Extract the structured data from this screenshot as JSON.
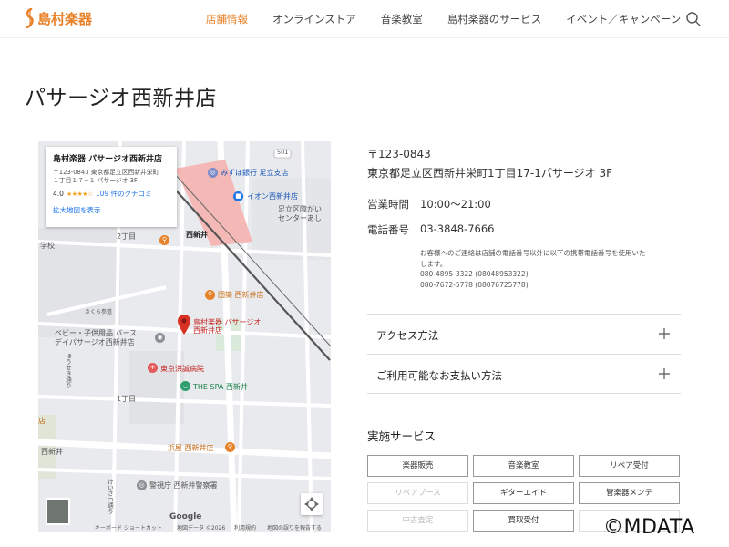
{
  "header": {
    "logo_text": "島村楽器",
    "nav": [
      "店舗情報",
      "オンラインストア",
      "音楽教室",
      "島村楽器のサービス",
      "イベント／キャンペーン"
    ],
    "accent": "#e8822a",
    "search_icon": "search-icon"
  },
  "page": {
    "title": "パサージオ西新井店"
  },
  "map": {
    "card": {
      "name": "島村楽器 パサージオ西新井店",
      "address_line1": "〒123-0843 東京都足立区西新井栄町",
      "address_line2": "１丁目１７−１ パサージオ 3F",
      "rating": "4.0",
      "stars": "★★★★☆",
      "reviews": "109 件のクチコミ",
      "expand_link": "拡大地図を表示"
    },
    "labels": {
      "bank": "みずほ銀行 足立支店",
      "aeon": "イオン西新井店",
      "ward1": "足立区障がい",
      "ward2": "センターあし",
      "station": "西新井",
      "road": "501",
      "block2": "2丁目",
      "school": "学校",
      "shop": "団欒 西新井店",
      "sakura": "さくら参道",
      "store_line1": "島村楽器 パサージオ",
      "store_line2": "西新井店",
      "baby1": "ベビー・子供用品 バース",
      "baby2": "デイパサージオ西新井店",
      "hospital": "東京洪誠病院",
      "spa": "THE SPA 西新井",
      "block1": "1丁目",
      "side_store": "店",
      "nishiarai": "西新井",
      "hamaya": "浜屋 西新井店",
      "police": "警視庁 西新井警察署",
      "road_v1": "ほうせき通り",
      "road_v2": "けいさつ通り"
    },
    "google": "Google",
    "footer": [
      "キーボード ショートカット",
      "地図データ ©2026",
      "利用規約",
      "地図の誤りを報告する"
    ]
  },
  "info": {
    "postal": "〒123-0843",
    "address": "東京都足立区西新井栄町1丁目17-1パサージオ 3F",
    "hours_label": "営業時間",
    "hours": "10:00〜21:00",
    "phone_label": "電話番号",
    "phone": "03-3848-7666",
    "note1": "お客様へのご連絡は店舗の電話番号以外に以下の携帯電話番号を使用いた",
    "note2": "します。",
    "note3": "080-4895-3322 (08048953322)",
    "note4": "080-7672-5778 (08076725778)"
  },
  "accordions": [
    "アクセス方法",
    "ご利用可能なお支払い方法"
  ],
  "services": {
    "title": "実施サービス",
    "items": [
      {
        "label": "楽器販売",
        "active": true
      },
      {
        "label": "音楽教室",
        "active": true
      },
      {
        "label": "リペア受付",
        "active": true
      },
      {
        "label": "リペアブース",
        "active": false
      },
      {
        "label": "ギターエイド",
        "active": true
      },
      {
        "label": "管楽器メンテ",
        "active": true
      },
      {
        "label": "中古査定",
        "active": false
      },
      {
        "label": "買取受付",
        "active": true
      },
      {
        "label": "",
        "active": false
      }
    ]
  },
  "watermark": "©MDATA"
}
